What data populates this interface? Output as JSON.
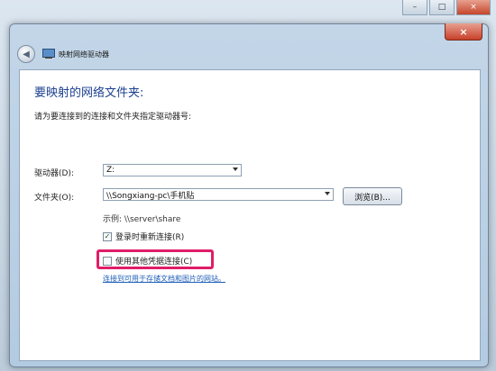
{
  "background": {
    "title_buttons": [
      "–",
      "□",
      "×"
    ]
  },
  "dialog": {
    "close_label": "×",
    "back_glyph": "◀",
    "title": "映射网络驱动器",
    "heading": "要映射的网络文件夹:",
    "subtext": "请为要连接到的连接和文件夹指定驱动器号:",
    "drive": {
      "label": "驱动器(D):",
      "value": "Z:"
    },
    "folder": {
      "label": "文件夹(O):",
      "value": "\\\\Songxiang-pc\\手机贴",
      "browse_label": "浏览(B)..."
    },
    "example": "示例: \\\\server\\share",
    "reconnect": {
      "label": "登录时重新连接(R)",
      "checked": true,
      "check_glyph": "✓"
    },
    "other_credentials": {
      "label": "使用其他凭据连接(C)",
      "checked": false
    },
    "link": "连接到可用于存储文档和图片的网站。"
  },
  "colors": {
    "heading": "#1b3f8f",
    "link": "#1f5fb8",
    "highlight": "#e01d68"
  }
}
